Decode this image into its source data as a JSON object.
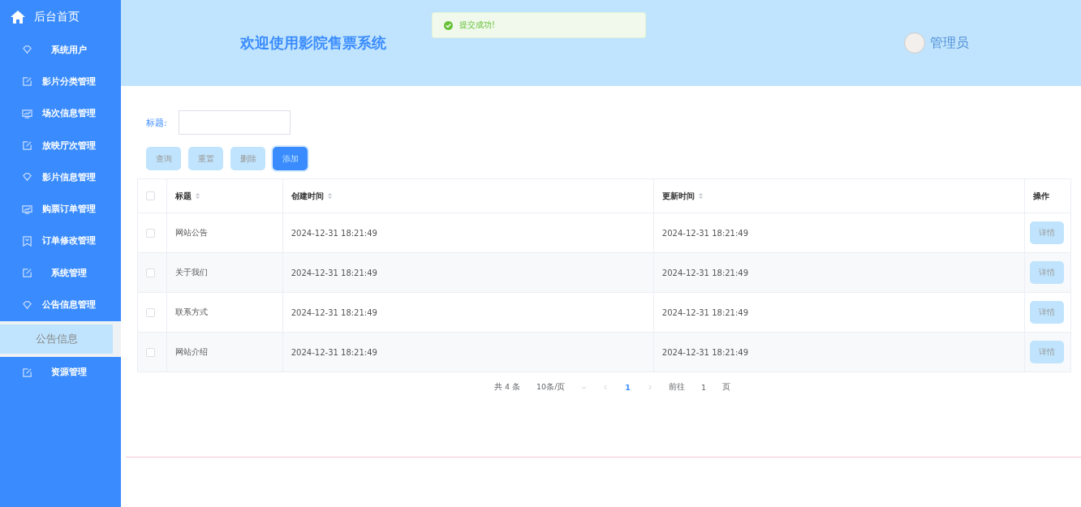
{
  "sidebar": {
    "home": {
      "label": "后台首页"
    },
    "items": [
      {
        "label": "系统用户",
        "kind": "diamond"
      },
      {
        "label": "影片分类管理",
        "kind": "edit"
      },
      {
        "label": "场次信息管理",
        "kind": "monitor"
      },
      {
        "label": "放映厅次管理",
        "kind": "edit"
      },
      {
        "label": "影片信息管理",
        "kind": "diamond"
      },
      {
        "label": "购票订单管理",
        "kind": "monitor"
      },
      {
        "label": "订单修改管理",
        "kind": "ticket"
      },
      {
        "label": "系统管理",
        "kind": "edit"
      },
      {
        "label": "公告信息管理",
        "kind": "diamond",
        "children": [
          {
            "label": "公告信息",
            "selected": true
          }
        ]
      },
      {
        "label": "资源管理",
        "kind": "edit"
      }
    ]
  },
  "header": {
    "title": "欢迎使用影院售票系统",
    "user": "管理员"
  },
  "toast": {
    "message": "提交成功!"
  },
  "search": {
    "label": "标题:"
  },
  "buttons": [
    {
      "label": "查询",
      "primary": false
    },
    {
      "label": "重置",
      "primary": false
    },
    {
      "label": "删除",
      "primary": false
    },
    {
      "label": "添加",
      "primary": true
    }
  ],
  "table": {
    "all_checked": false,
    "columns": [
      {
        "label": "标题",
        "sortable": true
      },
      {
        "label": "创建时间",
        "sortable": true
      },
      {
        "label": "更新时间",
        "sortable": true
      },
      {
        "label": "操作",
        "sortable": false
      }
    ],
    "rows": [
      {
        "checked": false,
        "title": "网站公告",
        "created": "2024-12-31 18:21:49",
        "updated": "2024-12-31 18:21:49",
        "action": "详情"
      },
      {
        "checked": false,
        "title": "关于我们",
        "created": "2024-12-31 18:21:49",
        "updated": "2024-12-31 18:21:49",
        "action": "详情"
      },
      {
        "checked": false,
        "title": "联系方式",
        "created": "2024-12-31 18:21:49",
        "updated": "2024-12-31 18:21:49",
        "action": "详情"
      },
      {
        "checked": false,
        "title": "网站介绍",
        "created": "2024-12-31 18:21:49",
        "updated": "2024-12-31 18:21:49",
        "action": "详情"
      }
    ]
  },
  "pagination": {
    "total": "共 4 条",
    "page_size": "10条/页",
    "pages": [
      {
        "label": "1",
        "selected": true
      }
    ],
    "goto_label": "前往",
    "goto_value": "1",
    "goto_suffix": "页"
  }
}
